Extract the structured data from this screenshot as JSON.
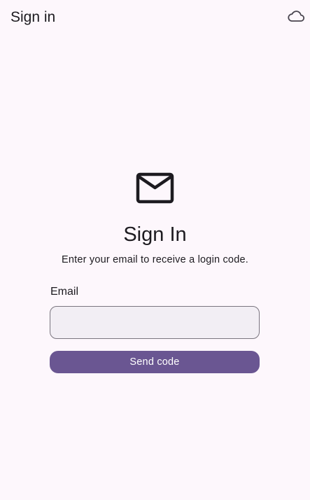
{
  "app_bar": {
    "title": "Sign in",
    "action_icon": "cloud-icon"
  },
  "main": {
    "icon": "mail-icon",
    "heading": "Sign In",
    "subtitle": "Enter your email to receive a login code.",
    "email_label": "Email",
    "email_value": "",
    "email_placeholder": "",
    "submit_label": "Send code"
  },
  "colors": {
    "background": "#fdf7fc",
    "primary": "#6a5692",
    "input_fill": "#f2eef4",
    "input_border": "#7a757f",
    "text": "#1d1b20"
  }
}
